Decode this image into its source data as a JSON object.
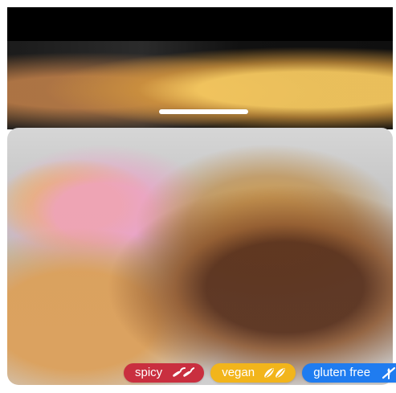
{
  "colors": {
    "spicy_bg": "#c92f3f",
    "vegan_bg": "#f2b51b",
    "gluten_bg": "#1f7cf0"
  },
  "tags": [
    {
      "label": "spicy",
      "icon": "chili-pepper-icon"
    },
    {
      "label": "vegan",
      "icon": "leaf-icon"
    },
    {
      "label": "gluten free",
      "icon": "wheat-slash-icon"
    }
  ]
}
